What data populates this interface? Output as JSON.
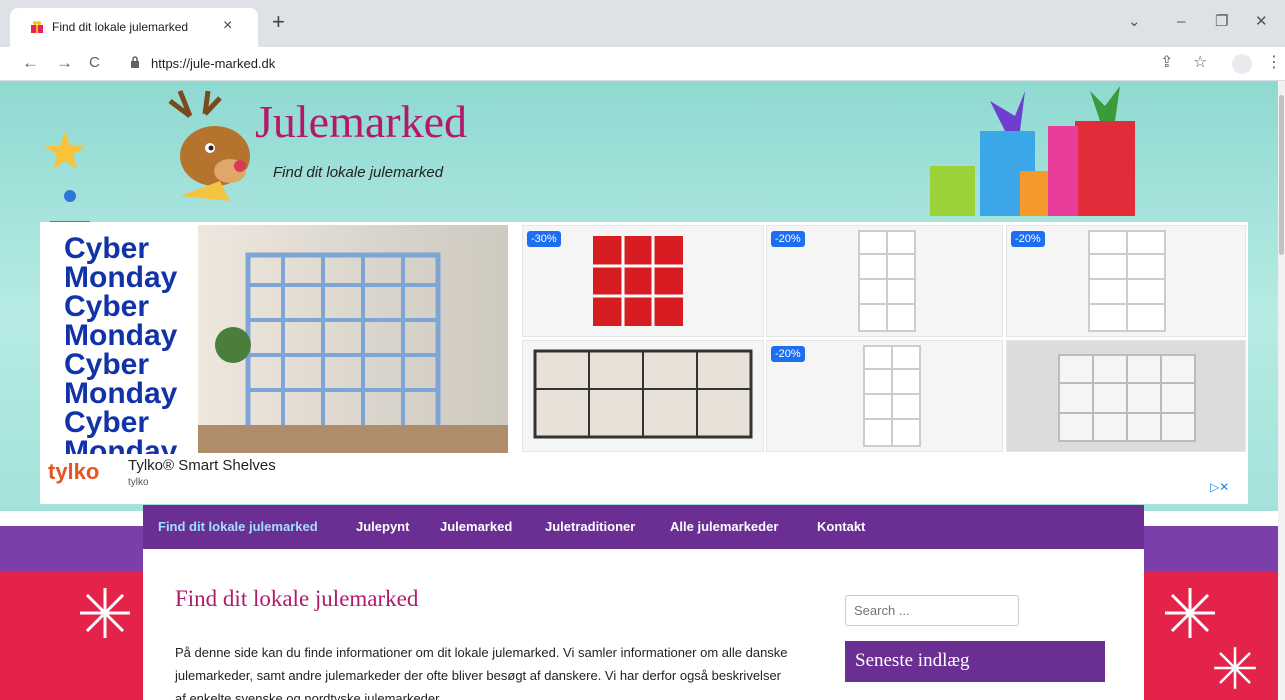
{
  "browser": {
    "tab_title": "Find dit lokale julemarked",
    "tab_close": "×",
    "new_tab": "+",
    "url": "https://jule-marked.dk",
    "back": "←",
    "forward": "→",
    "reload": "C",
    "share": "⇪",
    "star": "☆",
    "menu": "⋮",
    "minimize": "–",
    "restore": "❐",
    "close": "✕",
    "chevron": "⌄"
  },
  "header": {
    "site_title": "Julemarked",
    "tagline": "Find dit lokale julemarked"
  },
  "ad": {
    "cyber_lines": [
      "Cyber",
      "Monday",
      "Cyber",
      "Monday",
      "Cyber",
      "Monday",
      "Cyber",
      "Monday"
    ],
    "brand": "tylko",
    "title": "Tylko® Smart Shelves",
    "subtitle": "tylko",
    "badges": [
      "-30%",
      "-20%",
      "-20%",
      "-20%"
    ],
    "adchoices": "▷✕"
  },
  "nav": {
    "items": [
      {
        "label": "Find dit lokale julemarked"
      },
      {
        "label": "Julepynt"
      },
      {
        "label": "Julemarked"
      },
      {
        "label": "Juletraditioner"
      },
      {
        "label": "Alle julemarkeder"
      },
      {
        "label": "Kontakt"
      }
    ]
  },
  "main": {
    "title": "Find dit lokale julemarked",
    "paragraph": "På denne side kan du finde informationer om dit lokale julemarked. Vi samler informationer om alle danske julemarkeder, samt andre julemarkeder der ofte bliver besøgt af danskere. Vi har derfor også beskrivelser af enkelte svenske og nordtyske julemarkeder."
  },
  "sidebar": {
    "search_placeholder": "Search ...",
    "widget_title": "Seneste indlæg"
  },
  "colors": {
    "accent": "#b3196b",
    "nav": "#6b2f93",
    "brand_tylko": "#e8541e"
  }
}
